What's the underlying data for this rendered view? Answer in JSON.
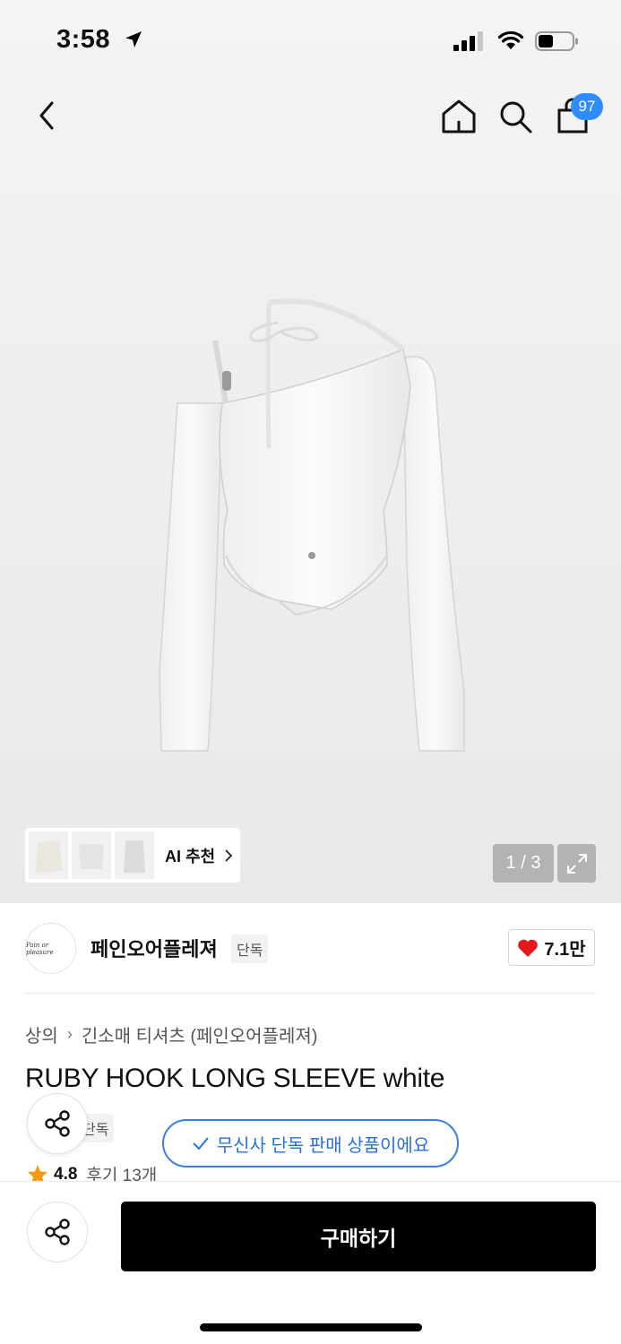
{
  "status_bar": {
    "time": "3:58",
    "icons": [
      "location-arrow-icon",
      "signal-icon",
      "wifi-icon",
      "battery-icon"
    ]
  },
  "nav": {
    "icons": [
      "back-icon",
      "home-icon",
      "search-icon",
      "bag-icon"
    ],
    "cart_count": "97",
    "accent_color": "#2f8cff"
  },
  "gallery": {
    "ai_label": "AI 추천",
    "counter": "1 / 3"
  },
  "brand": {
    "logo_text": "Pain or pleasure",
    "name": "페인오어플레져",
    "tag": "단독",
    "likes": "7.1만"
  },
  "breadcrumb": {
    "category": "상의",
    "subcategory": "긴소매 티셔츠 (페인오어플레져)"
  },
  "product": {
    "title": "RUBY HOOK LONG SLEEVE white",
    "tag": "단독",
    "rating": "4.8",
    "reviews": "후기 13개"
  },
  "exclusive_notice": {
    "text": "무신사 단독 판매 상품이에요",
    "color": "#2a6fde"
  },
  "bottom": {
    "buy_label": "구매하기"
  }
}
